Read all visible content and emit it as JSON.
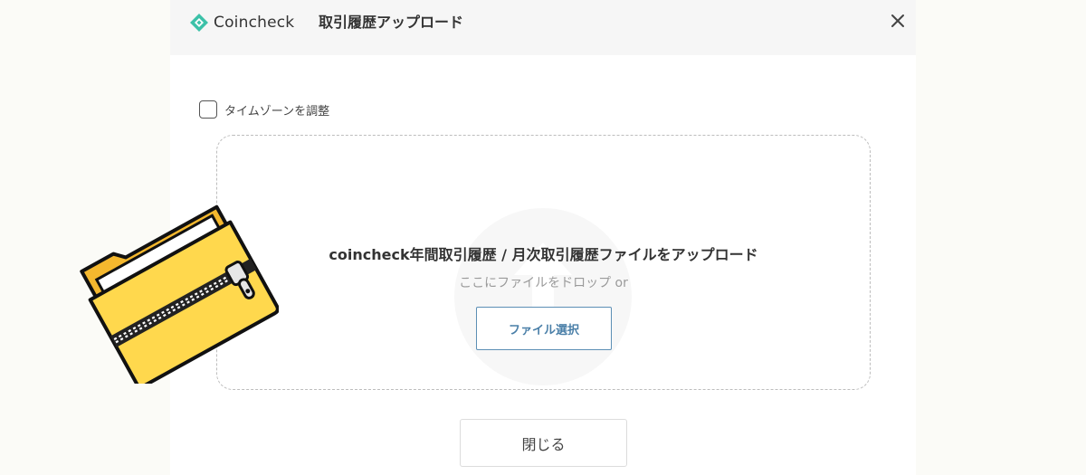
{
  "header": {
    "logo_text": "Coincheck",
    "title": "取引履歴アップロード",
    "close_icon": "close-icon"
  },
  "timezone": {
    "label": "タイムゾーンを調整",
    "checked": false
  },
  "dropzone": {
    "title": "coincheck年間取引履歴 / 月次取引履歴ファイルをアップロード",
    "subtitle": "ここにファイルをドロップ or",
    "select_button": "ファイル選択",
    "background_icon": "upload-icon"
  },
  "footer": {
    "close_label": "閉じる"
  },
  "decoration": {
    "icon": "zip-folder-icon"
  },
  "colors": {
    "brand": "#3cc1a8",
    "accent_blue": "#4a7fa8",
    "folder_yellow": "#ffd84d"
  }
}
